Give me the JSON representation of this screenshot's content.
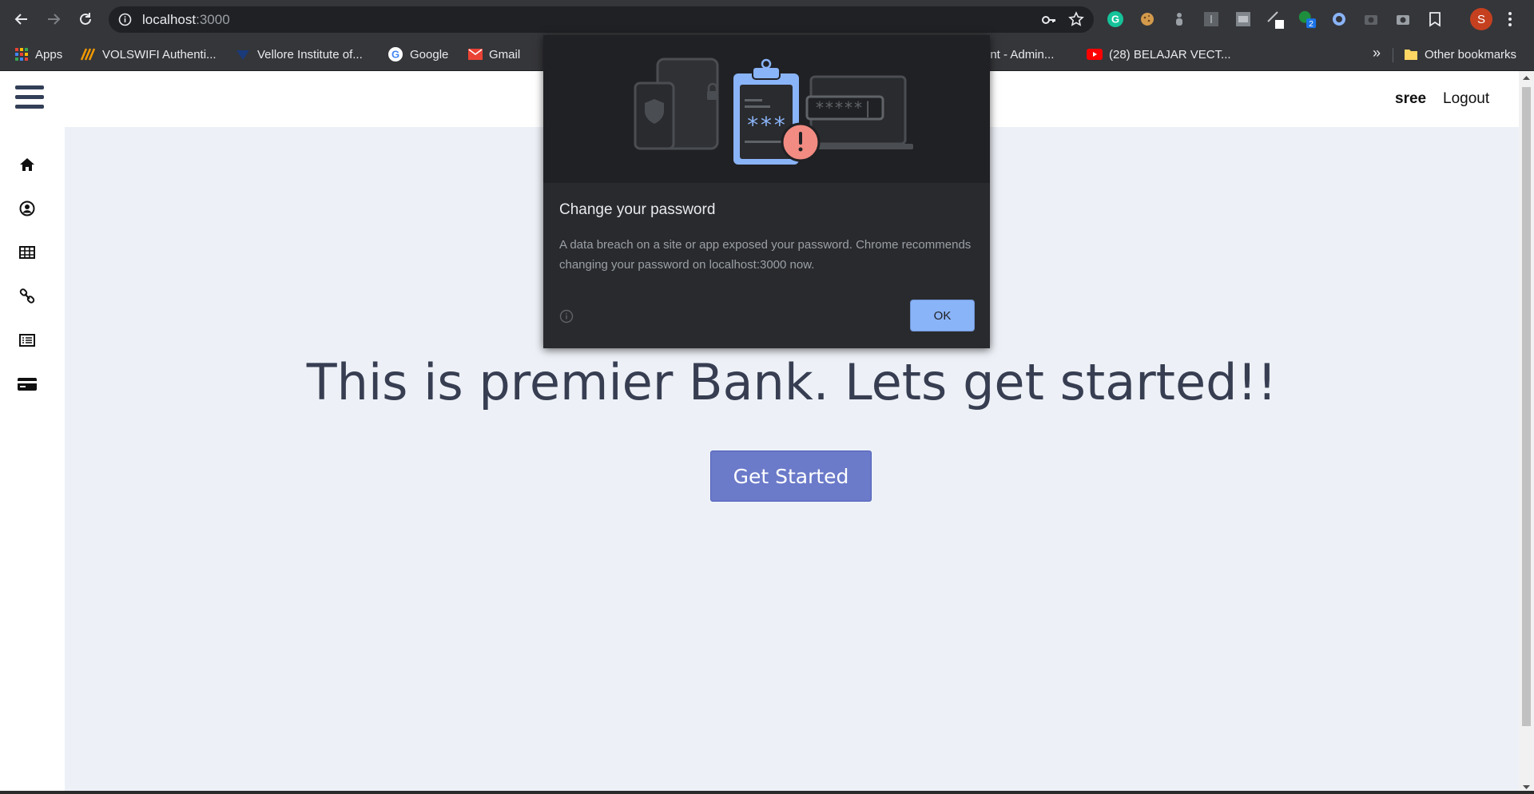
{
  "browser": {
    "url_host": "localhost",
    "url_port": ":3000",
    "avatar_letter": "S",
    "ext_badge": "2"
  },
  "bookmarks": [
    {
      "label": "Apps",
      "icon": "apps-grid-icon"
    },
    {
      "label": "VOLSWIFI Authenti...",
      "icon": "volswifi-icon"
    },
    {
      "label": "Vellore Institute of...",
      "icon": "vit-icon"
    },
    {
      "label": "Google",
      "icon": "google-icon"
    },
    {
      "label": "Gmail",
      "icon": "gmail-icon"
    },
    {
      "label": "int -  Admin...",
      "icon": ""
    },
    {
      "label": "(28) BELAJAR VECT...",
      "icon": "youtube-icon"
    },
    {
      "label": "Other bookmarks",
      "icon": "folder-icon"
    }
  ],
  "bookmarks_more": "»",
  "app": {
    "username": "sree",
    "logout": "Logout",
    "hero_text": "This is premier Bank. Lets get started!!",
    "cta": "Get Started",
    "sidebar_icons": [
      "home-icon",
      "user-circle-icon",
      "table-icon",
      "link-icon",
      "list-icon",
      "credit-card-icon"
    ]
  },
  "popup": {
    "title": "Change your password",
    "body": "A data breach on a site or app exposed your password. Chrome recommends changing your password on localhost:3000 now.",
    "ok": "OK",
    "illustration_text": "***",
    "field_text": "*****|"
  },
  "colors": {
    "accent": "#6b7ac9",
    "popup_button": "#8ab4f8",
    "content_bg": "#edf1f7"
  }
}
